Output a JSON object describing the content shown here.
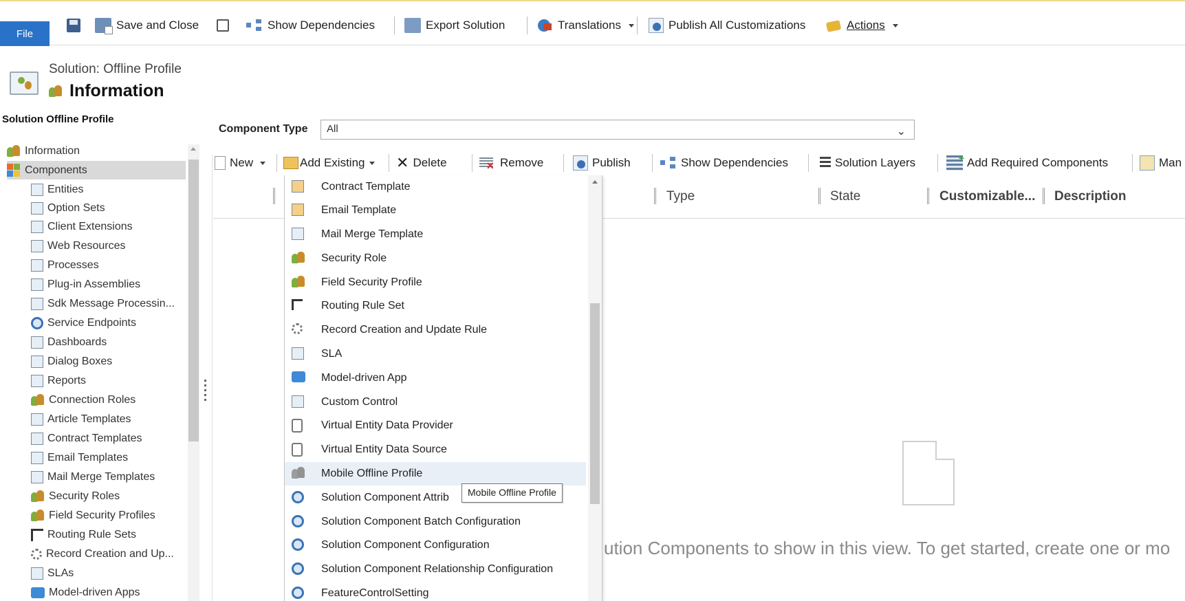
{
  "ribbon": {
    "file": "File",
    "save_close": "Save and Close",
    "show_dependencies": "Show Dependencies",
    "export_solution": "Export Solution",
    "translations": "Translations",
    "publish_all": "Publish All Customizations",
    "actions": "Actions"
  },
  "header": {
    "subtitle": "Solution: Offline Profile",
    "title": "Information"
  },
  "nav": {
    "heading": "Solution Offline Profile",
    "items": [
      "Information",
      "Components",
      "Entities",
      "Option Sets",
      "Client Extensions",
      "Web Resources",
      "Processes",
      "Plug-in Assemblies",
      "Sdk Message Processin...",
      "Service Endpoints",
      "Dashboards",
      "Dialog Boxes",
      "Reports",
      "Connection Roles",
      "Article Templates",
      "Contract Templates",
      "Email Templates",
      "Mail Merge Templates",
      "Security Roles",
      "Field Security Profiles",
      "Routing Rule Sets",
      "Record Creation and Up...",
      "SLAs",
      "Model-driven Apps"
    ]
  },
  "component_type": {
    "label": "Component Type",
    "value": "All"
  },
  "grid_toolbar": {
    "new": "New",
    "add_existing": "Add Existing",
    "delete": "Delete",
    "remove": "Remove",
    "publish": "Publish",
    "show_dependencies": "Show Dependencies",
    "solution_layers": "Solution Layers",
    "add_required": "Add Required Components",
    "manage": "Man"
  },
  "grid": {
    "columns": [
      "Type",
      "State",
      "Customizable...",
      "Description"
    ],
    "empty_message": "ution Components to show in this view. To get started, create one or mo"
  },
  "dropdown": {
    "items": [
      "Contract Template",
      "Email Template",
      "Mail Merge Template",
      "Security Role",
      "Field Security Profile",
      "Routing Rule Set",
      "Record Creation and Update Rule",
      "SLA",
      "Model-driven App",
      "Custom Control",
      "Virtual Entity Data Provider",
      "Virtual Entity Data Source",
      "Mobile Offline Profile",
      "Solution Component Attrib",
      "Solution Component Batch Configuration",
      "Solution Component Configuration",
      "Solution Component Relationship Configuration",
      "FeatureControlSetting"
    ],
    "hovered_item": "Mobile Offline Profile",
    "tooltip": "Mobile Offline Profile"
  },
  "colors": {
    "file_tab": "#2a72c7",
    "ribbon_top_border": "#f0d98c",
    "selected_nav": "#d9d9d9",
    "hover_row": "#e8eff7"
  }
}
